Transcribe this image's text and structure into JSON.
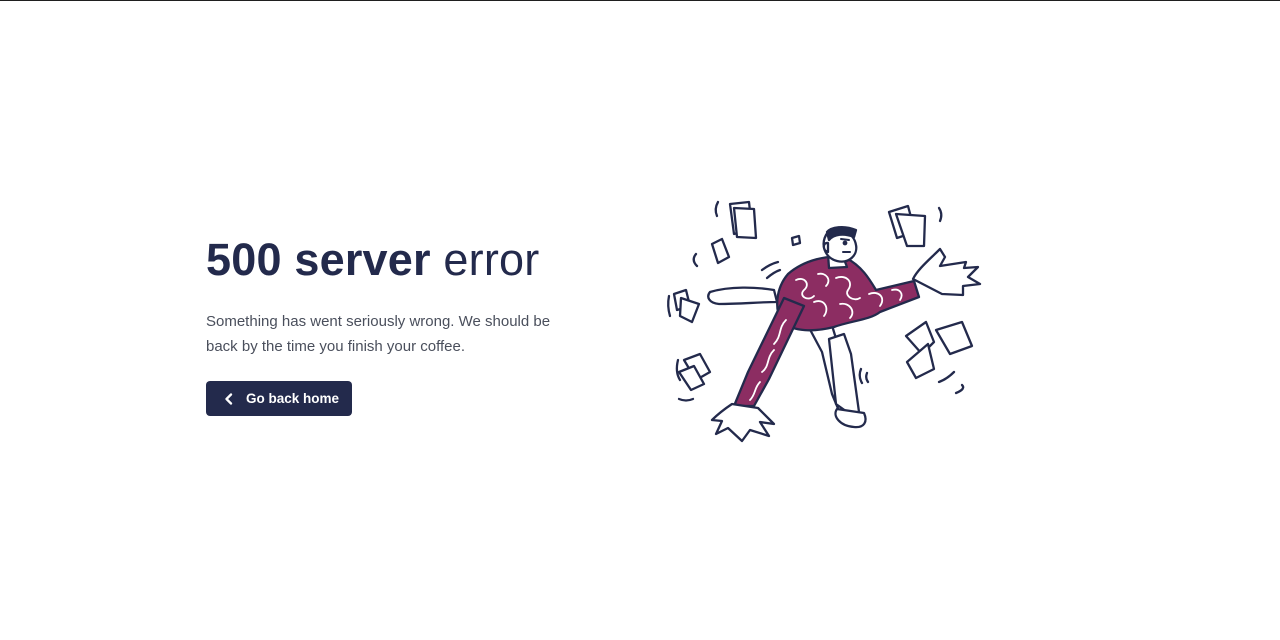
{
  "error": {
    "title_strong": "500 server",
    "title_light": "error",
    "description": "Something has went seriously wrong. We should be back by the time you finish your coffee.",
    "button_label": "Go back home",
    "button_icon": "chevron-left-icon"
  },
  "illustration": {
    "name": "stressed-person-with-flying-papers",
    "colors": {
      "ink": "#232a4c",
      "shirt": "#8c2d62",
      "paper": "#ffffff"
    }
  }
}
